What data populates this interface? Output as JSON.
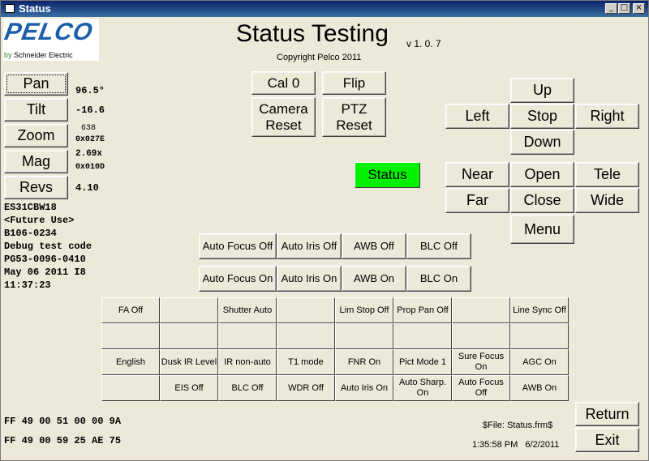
{
  "window": {
    "title": "Status",
    "min": "_",
    "max": "□",
    "close": "×"
  },
  "header": {
    "title": "Status Testing",
    "version": "v 1. 0. 7",
    "copyright": "Copyright Pelco 2011"
  },
  "logo": {
    "brand": "PELCO",
    "sub_by": "by",
    "sub_company": "Schneider Electric"
  },
  "mode_buttons": [
    "Pan",
    "Tilt",
    "Zoom",
    "Mag",
    "Revs"
  ],
  "readouts": [
    "96.5°",
    "-16.6",
    "638",
    "0x027E",
    "2.69x",
    "0x010D",
    "4.10"
  ],
  "info_lines": [
    "ES31CBW18",
    "<Future Use>",
    "B106-0234",
    "Debug test code",
    "PG53-0096-0410",
    "May 06 2011 I8",
    "11:37:23"
  ],
  "center_buttons": {
    "cal": "Cal 0",
    "flip": "Flip",
    "camera_reset": "Camera\nReset",
    "ptz_reset": "PTZ\nReset"
  },
  "status_button": "Status",
  "ptz": {
    "up": "Up",
    "left": "Left",
    "stop": "Stop",
    "right": "Right",
    "down": "Down"
  },
  "lens": {
    "near": "Near",
    "open": "Open",
    "tele": "Tele",
    "far": "Far",
    "close": "Close",
    "wide": "Wide",
    "menu": "Menu"
  },
  "toggles_off": [
    "Auto Focus Off",
    "Auto Iris Off",
    "AWB Off",
    "BLC Off"
  ],
  "toggles_on": [
    "Auto Focus On",
    "Auto Iris On",
    "AWB On",
    "BLC On"
  ],
  "grid_rows": [
    [
      "FA Off",
      "",
      "Shutter Auto",
      "",
      "Lim Stop Off",
      "Prop Pan Off",
      "",
      "Line Sync Off"
    ],
    [
      "",
      "",
      "",
      "",
      "",
      "",
      "",
      ""
    ],
    [
      "English",
      "Dusk IR Level",
      "IR non-auto",
      "T1 mode",
      "FNR On",
      "Pict Mode 1",
      "Sure Focus On",
      "AGC On"
    ],
    [
      "",
      "EIS Off",
      "BLC Off",
      "WDR Off",
      "Auto Iris On",
      "Auto Sharp. On",
      "Auto Focus Off",
      "AWB On"
    ]
  ],
  "hex_lines": [
    "FF 49 00 51 00 00 9A",
    "FF 49 00 59 25 AE 75"
  ],
  "file_label": "$File: Status.frm$",
  "timestamp": "1:35:58 PM   6/2/2011",
  "bottom_buttons": {
    "return": "Return",
    "exit": "Exit"
  }
}
